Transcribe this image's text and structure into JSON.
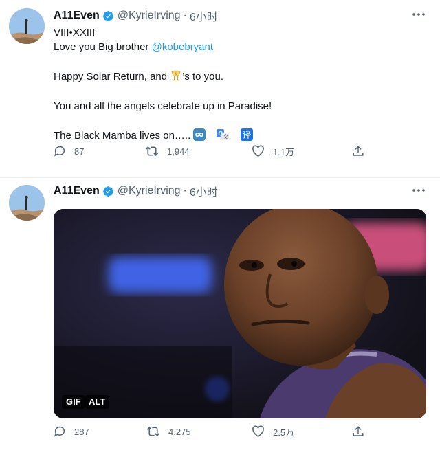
{
  "tweets": [
    {
      "author_name": "A11Even",
      "handle": "@KyrieIrving",
      "separator": "·",
      "time": "6小时",
      "lines": {
        "l1": "VIII•XXIII",
        "l2_text": "Love you Big brother ",
        "l2_mention": "@kobebryant",
        "l3_before": "Happy Solar Return, and ",
        "l3_after": "’s to you.",
        "l4": "You and all the angels celebrate up in Paradise!",
        "l5": "The Black Mamba lives on….."
      },
      "icons": [
        "clinking-glasses-emoji",
        "infinity-emoji",
        "translate-icon",
        "translate-zh-icon"
      ],
      "replies": "87",
      "retweets": "1,944",
      "likes": "1.1万"
    },
    {
      "author_name": "A11Even",
      "handle": "@KyrieIrving",
      "separator": "·",
      "time": "6小时",
      "media_badges": {
        "gif": "GIF",
        "alt": "ALT"
      },
      "replies": "287",
      "retweets": "4,275",
      "likes": "2.5万"
    }
  ],
  "colors": {
    "accent": "#1d9bf0",
    "secondary_text": "#536471",
    "text": "#0f1419"
  }
}
